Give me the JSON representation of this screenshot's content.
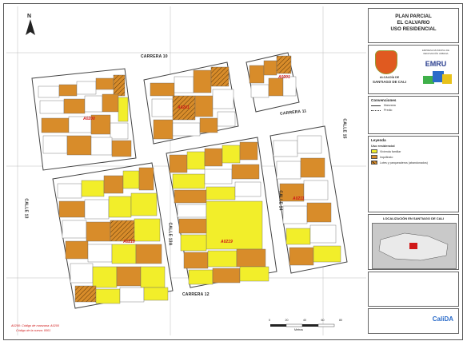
{
  "title": {
    "line1": "PLAN PARCIAL",
    "line2": "EL CALVARIO",
    "line3": "USO RESIDENCIAL"
  },
  "logos": {
    "alcaldia_line1": "ALCALDÍA DE",
    "alcaldia_line2": "SANTIAGO DE CALI",
    "emru": "EMRU",
    "emru_sub": "EMPRESA MUNICIPAL DE RENOVACIÓN URBANA",
    "calida": "CaliDA"
  },
  "convenciones": {
    "heading": "Convenciones",
    "items": [
      "Manzana",
      "Predio"
    ]
  },
  "leyenda": {
    "heading": "Leyenda",
    "subheading": "Uso residencial",
    "items": [
      {
        "label": "Vivienda familiar",
        "color": "#f2ee2a"
      },
      {
        "label": "Inquilinato",
        "color": "#d88c2a"
      },
      {
        "label": "Lotes y parqueaderos (abandonados)",
        "color": "#ffffff"
      }
    ]
  },
  "localizacion": {
    "heading": "LOCALIZACIÓN EN SANTIAGO DE CALI"
  },
  "streets": {
    "carrera10": "CARRERA 10",
    "carrera11": "CARRERA 11",
    "carrera12": "CARRERA 12",
    "calle13": "CALLE 13",
    "calle14": "CALLE 14",
    "calle15": "CALLE 15",
    "calle13a": "CALLE 13A"
  },
  "block_labels": {
    "a": "A0200",
    "b": "A0201",
    "c": "A0210",
    "d": "A0211",
    "e": "A0201",
    "f": "A0219"
  },
  "footnotes": {
    "line1": "A0200: Código de manzana: A0200",
    "line2": "Código de la nueva: 0001"
  },
  "scale": {
    "ticks": [
      "0",
      "20",
      "40",
      "60",
      "80"
    ],
    "unit": "Metros"
  },
  "colors": {
    "yellow": "#f2ee2a",
    "orange": "#d88c2a",
    "street": "#ffffff",
    "block_outline": "#444444"
  }
}
